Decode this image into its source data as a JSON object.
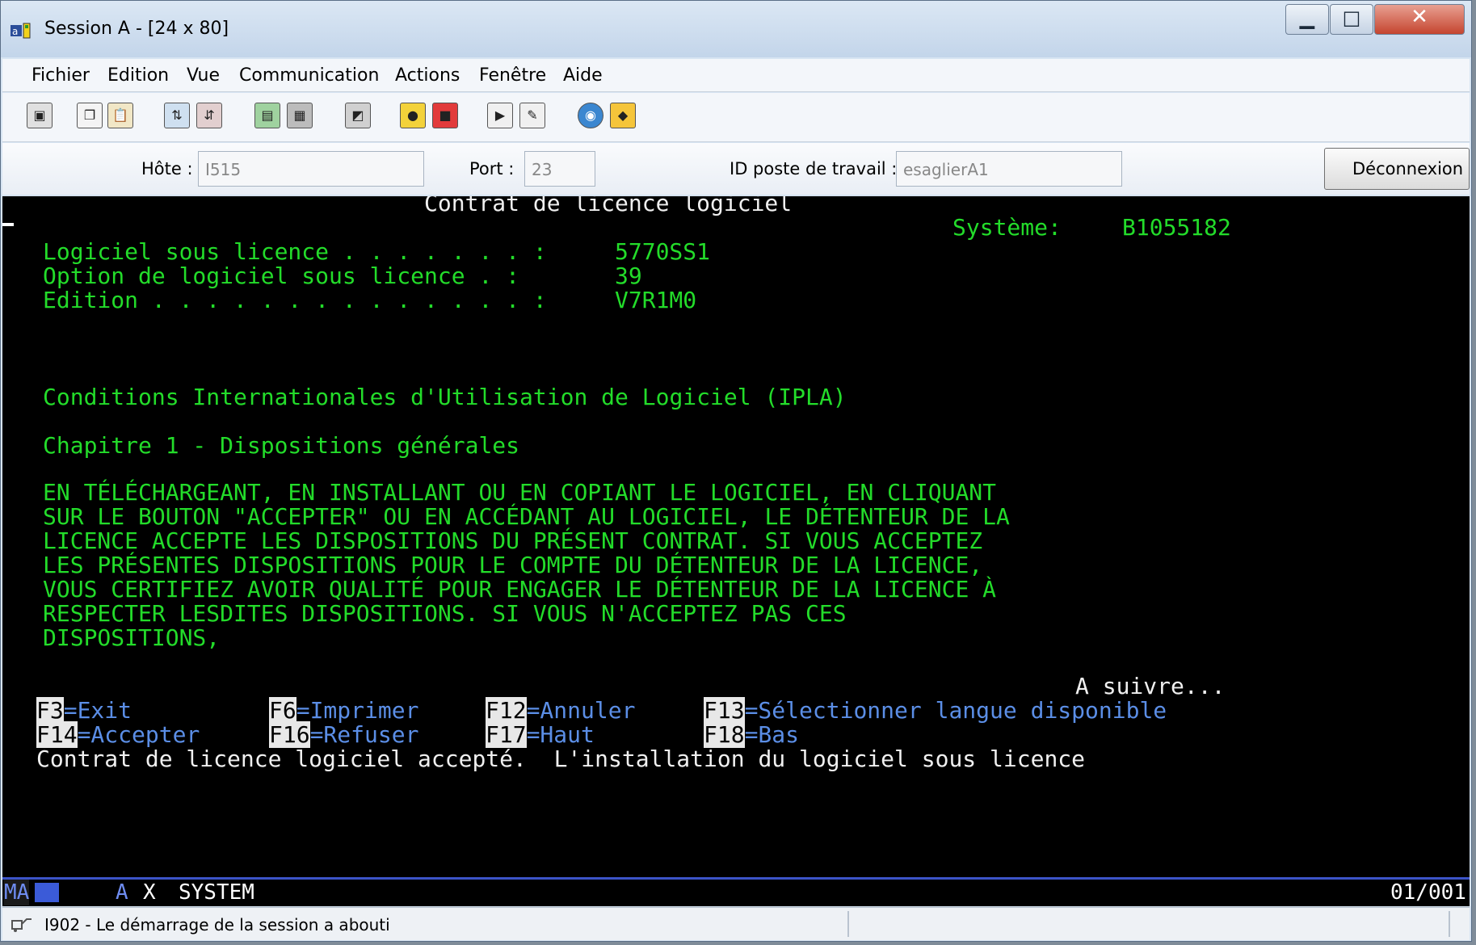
{
  "window": {
    "title": "Session A - [24 x 80]"
  },
  "menu": [
    "Fichier",
    "Edition",
    "Vue",
    "Communication",
    "Actions",
    "Fenêtre",
    "Aide"
  ],
  "connection": {
    "host_label": "Hôte :",
    "host_value": "I515",
    "port_label": "Port :",
    "port_value": "23",
    "workstation_label": "ID poste de travail :",
    "workstation_value": "esaglierA1",
    "disconnect_label": "Déconnexion"
  },
  "terminal": {
    "title": "Contrat de licence logiciel",
    "system_label": "Système:",
    "system_value": "B1055182",
    "fields": [
      {
        "label": "Logiciel sous licence . . . . . . . :",
        "value": "5770SS1"
      },
      {
        "label": "Option de logiciel sous licence . :",
        "value": "39"
      },
      {
        "label": "Edition . . . . . . . . . . . . . . :",
        "value": "V7R1M0"
      }
    ],
    "heading": "Conditions Internationales d'Utilisation de Logiciel (IPLA)",
    "chapter": "Chapitre 1 - Dispositions générales",
    "body_lines": [
      "EN TÉLÉCHARGEANT, EN INSTALLANT OU EN COPIANT LE LOGICIEL, EN CLIQUANT",
      "SUR LE BOUTON \"ACCEPTER\" OU EN ACCÉDANT AU LOGICIEL, LE DÉTENTEUR DE LA",
      "LICENCE ACCEPTE LES DISPOSITIONS DU PRÉSENT CONTRAT. SI VOUS ACCEPTEZ",
      "LES PRÉSENTES DISPOSITIONS POUR LE COMPTE DU DÉTENTEUR DE LA LICENCE,",
      "VOUS CERTIFIEZ AVOIR QUALITÉ POUR ENGAGER LE DÉTENTEUR DE LA LICENCE À",
      "RESPECTER LESDITES DISPOSITIONS. SI VOUS N'ACCEPTEZ PAS CES",
      "DISPOSITIONS,"
    ],
    "more": "A suivre...",
    "fkeys_row1": [
      {
        "key": "F3",
        "label": "=Exit"
      },
      {
        "key": "F6",
        "label": "=Imprimer"
      },
      {
        "key": "F12",
        "label": "=Annuler"
      },
      {
        "key": "F13",
        "label": "=Sélectionner langue disponible"
      }
    ],
    "fkeys_row2": [
      {
        "key": "F14",
        "label": "=Accepter"
      },
      {
        "key": "F16",
        "label": "=Refuser"
      },
      {
        "key": "F17",
        "label": "=Haut"
      },
      {
        "key": "F18",
        "label": "=Bas"
      }
    ],
    "message": "Contrat de licence logiciel accepté.  L'installation du logiciel sous licence"
  },
  "oia": {
    "mode": "MA",
    "session": "A",
    "x_mark": "X",
    "state": "SYSTEM",
    "cursor_pos": "01/001"
  },
  "status": {
    "message": "I902 - Le démarrage de la session a abouti"
  }
}
